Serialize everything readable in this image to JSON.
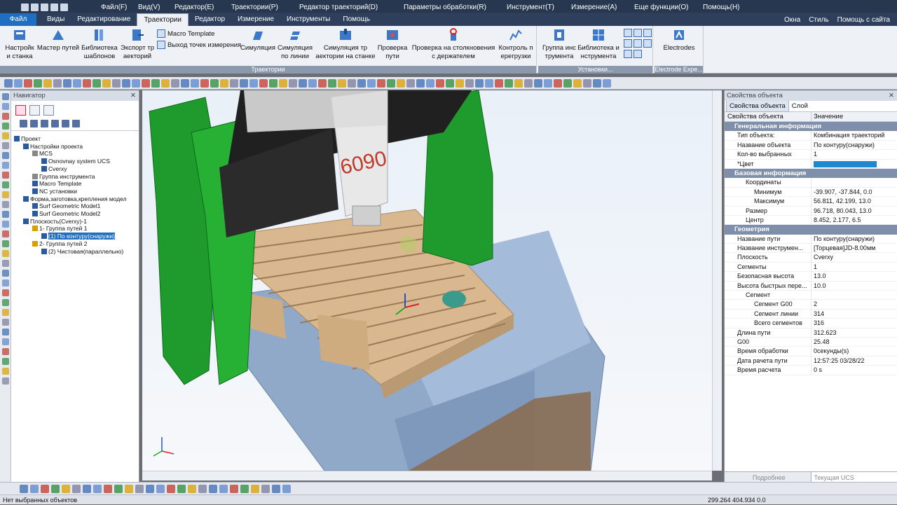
{
  "menu": {
    "items": [
      "Файл(F)",
      "Вид(V)",
      "Редактор(E)",
      "Траектории(P)",
      "Редактор траекторий(D)",
      "Параметры обработки(R)",
      "Инструмент(T)",
      "Измерение(A)",
      "Еще функции(O)",
      "Помощь(H)"
    ]
  },
  "tabs": {
    "first": "Файл",
    "items": [
      "Виды",
      "Редактирование",
      "Траектории",
      "Редактор",
      "Измерение",
      "Инструменты",
      "Помощь"
    ],
    "active": "Траектории",
    "right": [
      "Окна",
      "Стиль",
      "Помощь с сайта"
    ]
  },
  "ribbon": {
    "btn_setup": "Настройк и станка",
    "btn_wizard": "Мастер путей",
    "btn_library": "Библиотека шаблонов",
    "btn_export": "Экспорт тр аекторий",
    "macro_template": "Macro Template",
    "exit_points": "Выход точек измерения",
    "btn_sim": "Симуляция",
    "btn_sim_line": "Симуляция по линии",
    "btn_sim_machine": "Симуляция тр аектории на станке",
    "btn_check_path": "Проверка пути",
    "btn_check_holder": "Проверка на столкновения с держателем",
    "btn_overload": "Контроль п ерегрузки",
    "btn_tool_group": "Группа инс трумента",
    "btn_tool_library": "Библиотека и нструмента",
    "btn_electrodes": "Electrodes",
    "group_paths": "Траектории",
    "group_install": "Установки...",
    "group_electrode": "Electrode Expe..."
  },
  "navigator": {
    "title": "Навигатор",
    "tree": [
      {
        "label": "Проект",
        "indent": 0,
        "color": "#2a5aa0"
      },
      {
        "label": "Настройки проекта",
        "indent": 1,
        "color": "#2a5aa0"
      },
      {
        "label": "MCS",
        "indent": 2,
        "color": "#888"
      },
      {
        "label": "Osnovnay system UCS",
        "indent": 3,
        "color": "#2a5aa0"
      },
      {
        "label": "Cverxy",
        "indent": 3,
        "color": "#2a5aa0"
      },
      {
        "label": "Группа инструмента",
        "indent": 2,
        "color": "#888"
      },
      {
        "label": "Macro Template",
        "indent": 2,
        "color": "#2a5aa0"
      },
      {
        "label": "NC установки",
        "indent": 2,
        "color": "#2a5aa0"
      },
      {
        "label": "Форма,заготовка,крепления модел",
        "indent": 1,
        "color": "#2a5aa0"
      },
      {
        "label": "Surf Geometric Model1",
        "indent": 2,
        "color": "#2a5aa0"
      },
      {
        "label": "Surf Geometric Model2",
        "indent": 2,
        "color": "#2a5aa0"
      },
      {
        "label": "Плоскость(Cverxy)-1",
        "indent": 1,
        "color": "#2a5aa0"
      },
      {
        "label": "1- Группа путей 1",
        "indent": 2,
        "color": "#d8a000"
      },
      {
        "label": "(1) По контуру(снаружи)",
        "indent": 3,
        "color": "#2a5aa0",
        "selected": true
      },
      {
        "label": "2- Группа путей 2",
        "indent": 2,
        "color": "#d8a000"
      },
      {
        "label": "(2) Чистовая(параллельно)",
        "indent": 3,
        "color": "#2a5aa0"
      }
    ]
  },
  "viewport": {
    "machine_label": "6090"
  },
  "properties": {
    "title": "Свойства объекта",
    "tab_props": "Свойства объекта",
    "tab_layer": "Слой",
    "col_key": "Свойства объекта",
    "col_val": "Значение",
    "sections": [
      {
        "header": "Генеральная информация",
        "rows": [
          {
            "k": "Тип объекта:",
            "v": "Комбинация траекторий"
          },
          {
            "k": "Название объекта",
            "v": "По контуру(снаружи)"
          },
          {
            "k": "Кол-во выбранных",
            "v": "1"
          },
          {
            "k": "*Цвет",
            "v": "",
            "color": "#1f86d0"
          }
        ]
      },
      {
        "header": "Базовая информация",
        "rows": [
          {
            "k": "Координаты",
            "v": "",
            "lvl": 1
          },
          {
            "k": "Минимум",
            "v": "-39.907, -37.844, 0.0",
            "lvl": 2
          },
          {
            "k": "Максимум",
            "v": "56.811, 42.199, 13.0",
            "lvl": 2
          },
          {
            "k": "Размер",
            "v": "96.718, 80.043, 13.0",
            "lvl": 1
          },
          {
            "k": "Центр",
            "v": "8.452, 2.177, 6.5",
            "lvl": 1
          }
        ]
      },
      {
        "header": "Геометрия",
        "rows": [
          {
            "k": "Название пути",
            "v": "По контуру(снаружи)"
          },
          {
            "k": "Название инструмен...",
            "v": "[Торцевая]JD-8.00мм"
          },
          {
            "k": "Плоскость",
            "v": "Cverxy"
          },
          {
            "k": "Сегменты",
            "v": "1"
          },
          {
            "k": "Безопасная высота",
            "v": "13.0"
          },
          {
            "k": "Высота быстрых пере...",
            "v": "10.0"
          },
          {
            "k": "Сегмент",
            "v": "",
            "lvl": 1
          },
          {
            "k": "Сегмент G00",
            "v": "2",
            "lvl": 2
          },
          {
            "k": "Сегмент линии",
            "v": "314",
            "lvl": 2
          },
          {
            "k": "Всего сегментов",
            "v": "316",
            "lvl": 2
          },
          {
            "k": "Длина пути",
            "v": "312.623"
          },
          {
            "k": "G00",
            "v": "25.48"
          },
          {
            "k": "Время обработки",
            "v": "0секунды(s)"
          },
          {
            "k": "Дата рачета пути",
            "v": "12:57:25 03/28/22"
          },
          {
            "k": "Время расчета",
            "v": "0 s"
          }
        ]
      }
    ],
    "footer_more": "Подробнее",
    "footer_ucs": "Текущая UCS"
  },
  "status": {
    "text": "Нет выбранных объектов",
    "coords": "299.264 404.934 0.0"
  }
}
